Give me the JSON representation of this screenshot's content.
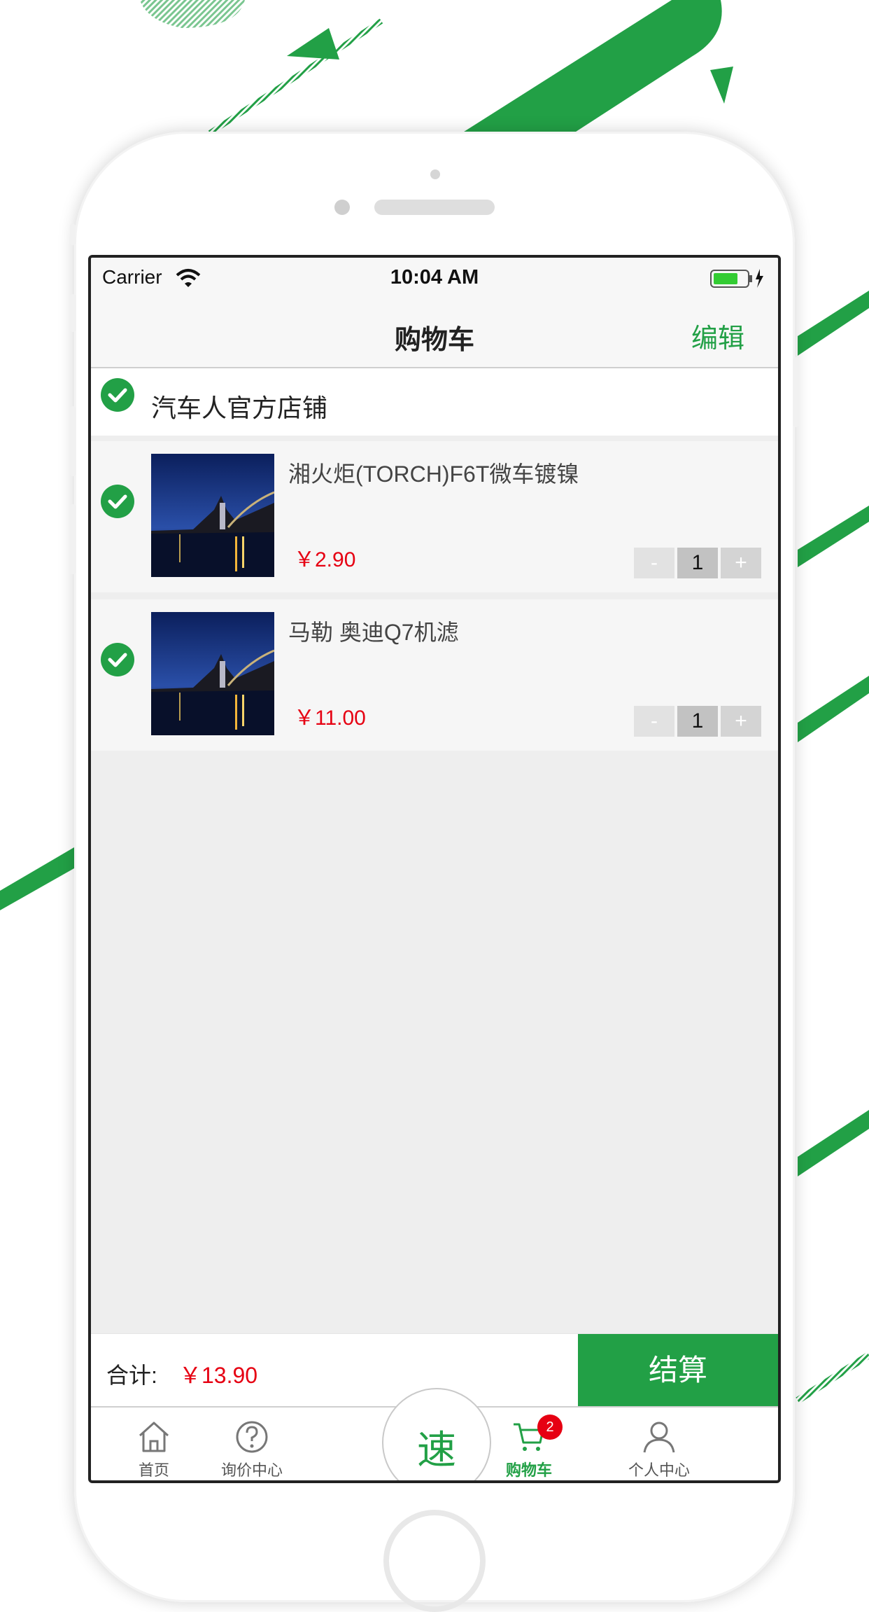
{
  "status_bar": {
    "carrier": "Carrier",
    "time": "10:04 AM"
  },
  "nav": {
    "title": "购物车",
    "edit_label": "编辑"
  },
  "shop": {
    "name": "汽车人官方店铺"
  },
  "cart_items": [
    {
      "title": "湘火炬(TORCH)F6T微车镀镍",
      "price": "￥2.90",
      "quantity": "1",
      "minus": "-",
      "plus": "+"
    },
    {
      "title": "马勒 奥迪Q7机滤",
      "price": "￥11.00",
      "quantity": "1",
      "minus": "-",
      "plus": "+"
    }
  ],
  "footer": {
    "total_label": "合计:",
    "total_value": "￥13.90",
    "checkout_label": "结算"
  },
  "tabbar": {
    "home": "首页",
    "inquiry": "询价中心",
    "speed": "速",
    "cart": "购物车",
    "cart_badge": "2",
    "profile": "个人中心"
  },
  "colors": {
    "accent": "#22a046",
    "price": "#e60012"
  }
}
